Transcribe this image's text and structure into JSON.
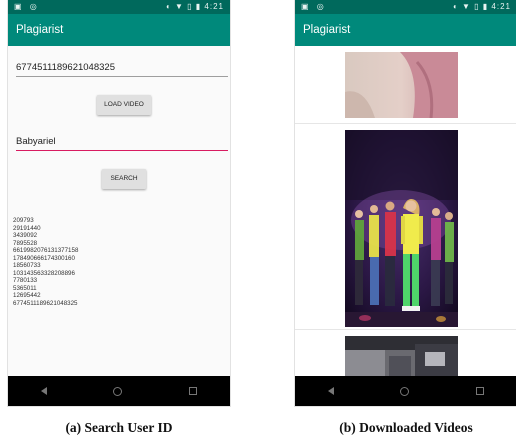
{
  "screens": [
    {
      "status": {
        "left_icons": "▣ ◎",
        "right_icons": "◐ ▼ ▯ ▮",
        "time": "4:21"
      },
      "app_title": "Plagiarist",
      "video_id_value": "6774511189621048325",
      "load_button_label": "LOAD VIDEO",
      "username_value": "Babyariel",
      "search_button_label": "SEARCH",
      "results": [
        "209793",
        "29191440",
        "3439092",
        "7895528",
        "6619982076131377158",
        "178490666174300160",
        "18560733",
        "103143563328208896",
        "7780133",
        "5365011",
        "12695442",
        "6774511189621048325"
      ]
    },
    {
      "status": {
        "left_icons": "▣ ◎",
        "right_icons": "◐ ▼ ▯ ▮",
        "time": "4:21"
      },
      "app_title": "Plagiarist"
    }
  ],
  "captions": {
    "a": "(a) Search User ID",
    "b": "(b) Downloaded Videos"
  },
  "colors": {
    "app_bar": "#00897b",
    "status_bar": "#00695c",
    "accent_underline": "#d81b60"
  }
}
